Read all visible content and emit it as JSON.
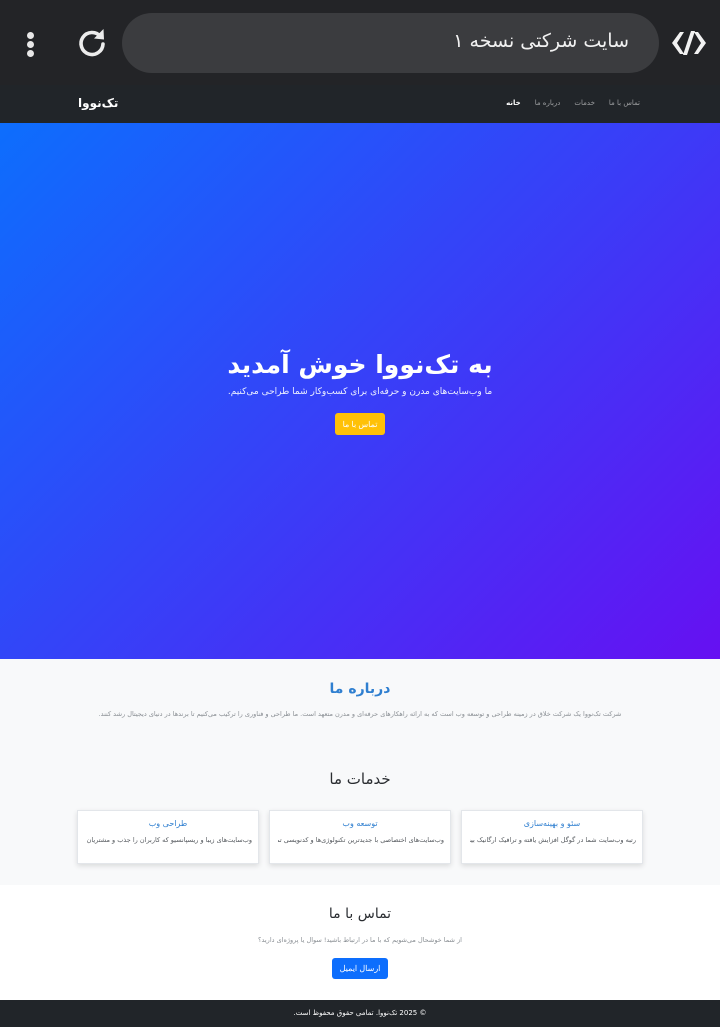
{
  "browser": {
    "tab_title": "سایت شرکتی نسخه ۱",
    "icons": {
      "menu": "more-vert-icon",
      "reload": "reload-icon",
      "site": "code-brackets-icon"
    }
  },
  "navbar": {
    "brand": "تک‌نووا",
    "links": [
      "خانه",
      "درباره ما",
      "خدمات",
      "تماس با ما"
    ],
    "active_index": 0
  },
  "hero": {
    "title": "به تک‌نووا خوش آمدید",
    "subtitle": "ما وب‌سایت‌های مدرن و حرفه‌ای برای کسب‌وکار شما طراحی می‌کنیم.",
    "cta_label": "تماس با ما"
  },
  "about": {
    "title": "درباره ما",
    "text": "شرکت تک‌نووا یک شرکت خلاق در زمینه طراحی و توسعه وب است که به ارائه راهکارهای حرفه‌ای و مدرن متعهد است. ما طراحی و فناوری را ترکیب می‌کنیم تا برندها در دنیای دیجیتال رشد کنند."
  },
  "services": {
    "title": "خدمات ما",
    "items": [
      {
        "title": "طراحی وب",
        "text": "وب‌سایت‌های زیبا و ریسپانسیو که کاربران را جذب و مشتریان را تبدیل می‌کنند."
      },
      {
        "title": "توسعه وب",
        "text": "وب‌سایت‌های اختصاصی با جدیدترین تکنولوژی‌ها و کدنویسی تمیز."
      },
      {
        "title": "سئو و بهینه‌سازی",
        "text": "رتبه وب‌سایت شما در گوگل افزایش یافته و ترافیک ارگانیک بیشتری جذب می‌کنید."
      }
    ]
  },
  "contact": {
    "title": "تماس با ما",
    "text": "از شما خوشحال می‌شویم که با ما در ارتباط باشید! سوال یا پروژه‌ای دارید؟",
    "button_label": "ارسال ایمیل"
  },
  "footer": {
    "text": "© 2025 تک‌نووا. تمامی حقوق محفوظ است."
  },
  "colors": {
    "hero_gradient_start": "#0d6efd",
    "hero_gradient_end": "#6610f2",
    "cta_yellow": "#ffc107",
    "primary_blue": "#0d6efd",
    "dark": "#212529"
  }
}
